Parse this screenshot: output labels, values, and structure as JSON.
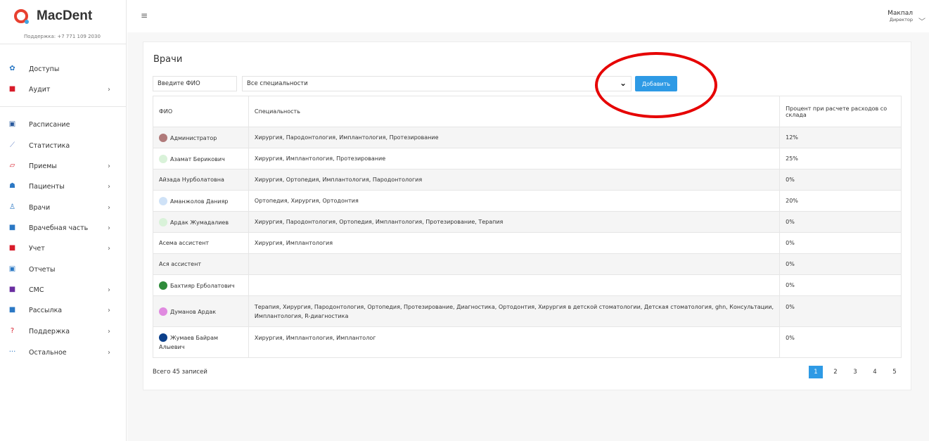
{
  "brand": {
    "name": "MacDent",
    "support": "Поддержка: +7 771 109 2030"
  },
  "sidebar": {
    "items": [
      {
        "label": "Доступы",
        "icon": "gear-icon",
        "color": "#2b78c4",
        "glyph": "✿",
        "arrow": ""
      },
      {
        "label": "Аудит",
        "icon": "audit-icon",
        "color": "#d81b2a",
        "glyph": "■",
        "arrow": "›"
      },
      {
        "label": "Расписание",
        "icon": "calendar-icon",
        "color": "#2b5b9e",
        "glyph": "▣",
        "arrow": ""
      },
      {
        "label": "Статистика",
        "icon": "chart-icon",
        "color": "#6a88c8",
        "glyph": "⟋",
        "arrow": ""
      },
      {
        "label": "Приемы",
        "icon": "appointment-icon",
        "color": "#d81b2a",
        "glyph": "▱",
        "arrow": "›"
      },
      {
        "label": "Пациенты",
        "icon": "patients-icon",
        "color": "#2b78c4",
        "glyph": "☗",
        "arrow": "›"
      },
      {
        "label": "Врачи",
        "icon": "doctor-icon",
        "color": "#2b78c4",
        "glyph": "♙",
        "arrow": "›"
      },
      {
        "label": "Врачебная часть",
        "icon": "medical-bag-icon",
        "color": "#2b78c4",
        "glyph": "■",
        "arrow": "›"
      },
      {
        "label": "Учет",
        "icon": "accounting-icon",
        "color": "#d81b2a",
        "glyph": "■",
        "arrow": "›"
      },
      {
        "label": "Отчеты",
        "icon": "report-icon",
        "color": "#2b78c4",
        "glyph": "▣",
        "arrow": ""
      },
      {
        "label": "СМС",
        "icon": "sms-icon",
        "color": "#6a2ea0",
        "glyph": "■",
        "arrow": "›"
      },
      {
        "label": "Рассылка",
        "icon": "mailing-icon",
        "color": "#2b78c4",
        "glyph": "■",
        "arrow": "›"
      },
      {
        "label": "Поддержка",
        "icon": "help-icon",
        "color": "#d81b2a",
        "glyph": "?",
        "arrow": "›"
      },
      {
        "label": "Остальное",
        "icon": "more-icon",
        "color": "#2b78c4",
        "glyph": "···",
        "arrow": "›"
      }
    ]
  },
  "header": {
    "menu_icon": "≡",
    "user_name": "Макпал",
    "user_role": "Директор"
  },
  "page": {
    "title": "Врачи",
    "search_value": "Введите ФИО",
    "specialty_value": "Все специальности",
    "add_label": "Добавить"
  },
  "table": {
    "headers": [
      "ФИО",
      "Специальность",
      "Процент при расчете расходов со склада"
    ],
    "rows": [
      {
        "name": "Администратор",
        "color": "#b07a7a",
        "spec": "Хирургия, Пародонтология, Имплантология, Протезирование",
        "pct": "12%"
      },
      {
        "name": "Азамат Берикович",
        "color": "#d9f2d9",
        "spec": "Хирургия, Имплантология, Протезирование",
        "pct": "25%"
      },
      {
        "name": "Айзада Нурболатовна",
        "color": "",
        "spec": "Хирургия, Ортопедия, Имплантология, Пародонтология",
        "pct": "0%"
      },
      {
        "name": "Аманжолов Данияр",
        "color": "#cfe2f7",
        "spec": "Ортопедия, Хирургия, Ортодонтия",
        "pct": "20%"
      },
      {
        "name": "Ардак Жумадалиев",
        "color": "#d9f2d9",
        "spec": "Хирургия, Пародонтология, Ортопедия, Имплантология, Протезирование, Терапия",
        "pct": "0%"
      },
      {
        "name": "Асема ассистент",
        "color": "",
        "spec": "Хирургия, Имплантология",
        "pct": "0%"
      },
      {
        "name": "Ася ассистент",
        "color": "",
        "spec": "",
        "pct": "0%"
      },
      {
        "name": "Бахтияр Ерболатович",
        "color": "#2e8b3a",
        "spec": "",
        "pct": "0%"
      },
      {
        "name": "Думанов Ардак",
        "color": "#e08ae0",
        "spec": "Терапия, Хирургия, Пародонтология, Ортопедия, Протезирование, Диагностика, Ортодонтия, Хирургия в детской стоматологии, Детская стоматология, ghn, Консультации, Имплантология, R-диагностика",
        "pct": "0%"
      },
      {
        "name": "Жумаев Байрам Алыевич",
        "color": "#0b3f8a",
        "spec": "Хирургия, Имплантология, Имплантолог",
        "pct": "0%"
      }
    ]
  },
  "footer": {
    "total": "Всего 45 записей",
    "pages": [
      "1",
      "2",
      "3",
      "4",
      "5"
    ],
    "active_page": "1"
  },
  "colors": {
    "accent": "#2e9ae5",
    "highlight_oval": "#e60000"
  }
}
